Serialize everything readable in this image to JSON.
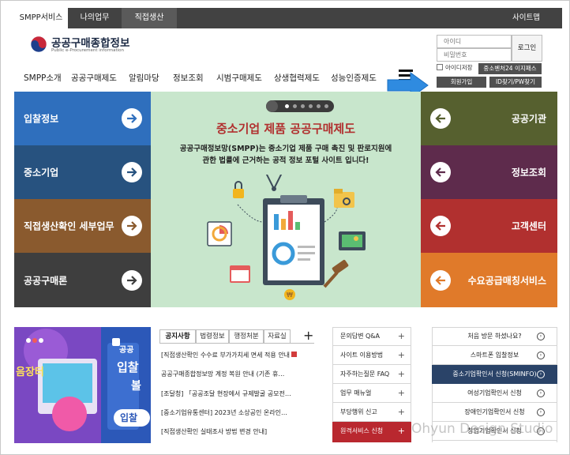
{
  "topbar": {
    "tabs": [
      "SMPP서비스",
      "나의업무",
      "직접생산"
    ],
    "sitemap": "사이트맵"
  },
  "header": {
    "logo_title": "공공구매종합정보",
    "logo_sub": "Public e-Procurement information",
    "nav": [
      "SMPP소개",
      "공공구매제도",
      "알림마당",
      "정보조회",
      "시범구매제도",
      "상생협력제도",
      "성능인증제도"
    ]
  },
  "login": {
    "id_placeholder": "아이디",
    "pw_placeholder": "비밀번호",
    "login_button": "로그인",
    "remember": "아이디저장",
    "venture_button": "중소벤처24 이지패스",
    "signup_button": "회원가입",
    "find_button": "ID찾기/PW찾기"
  },
  "tiles_left": [
    {
      "label": "입찰정보",
      "color": "#2f6fbd"
    },
    {
      "label": "중소기업",
      "color": "#27527f"
    },
    {
      "label": "직접생산확인 세부업무",
      "color": "#8a5a2e"
    },
    {
      "label": "공공구매론",
      "color": "#3e3e3e"
    }
  ],
  "tiles_right": [
    {
      "label": "공공기관",
      "color": "#56602f"
    },
    {
      "label": "정보조회",
      "color": "#5e2b4c"
    },
    {
      "label": "고객센터",
      "color": "#b1302f"
    },
    {
      "label": "수요공급매칭서비스",
      "color": "#e07a2a"
    }
  ],
  "hero": {
    "title": "중소기업 제품 공공구매제도",
    "line1": "공공구매정보망(SMPP)는 중소기업 제품 구매 촉진 및 판로지원에",
    "line2": "관한 법률에 근거하는 공적 정보 포털 사이트 입니다!"
  },
  "banner": {
    "text_top": "공공",
    "text_mid": "입찰",
    "text_side": "음장터",
    "text_btn": "입찰",
    "text_small": "볼"
  },
  "notices": {
    "tabs": [
      "공지사항",
      "법령정보",
      "행정처분",
      "자료실"
    ],
    "plus": "+",
    "items": [
      "[직접생산확인 수수료 부가가치세 면세 적용 안내",
      "공공구매종합정보망 계정 복원 안내 (기존 휴…",
      "[조달청] 「공공조달 현장에서 규제발굴 공모전…",
      "[중소기업유통센터] 2023년 소상공인 온라인…",
      "[직접생산확인 실태조사 방법 변경 안내]"
    ]
  },
  "qa": {
    "items": [
      "문의답변 Q&A",
      "사이트 이용방법",
      "자주하는질문 FAQ",
      "업무 매뉴얼",
      "부당행위 신고",
      "원격서비스 신청"
    ],
    "plus": "+"
  },
  "services": {
    "items": [
      "처음 방문 하셨나요?",
      "스마트폰 입찰정보",
      "중소기업확인서 신청(SMINFO)",
      "여성기업확인서 신청",
      "장애인기업확인서 신청",
      "창업기업확인서 신청"
    ],
    "go": "›"
  },
  "watermark": "Ohyun Design Studio"
}
